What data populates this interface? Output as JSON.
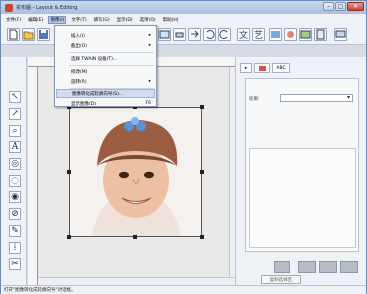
{
  "window": {
    "title": "花布圖 - Layout & Editing",
    "controls": [
      "–",
      "□",
      "✕"
    ]
  },
  "menubar": {
    "items": [
      {
        "label": "文件(F)"
      },
      {
        "label": "编辑(E)"
      },
      {
        "label": "图像(I)"
      },
      {
        "label": "文字(T)"
      },
      {
        "label": "填写(G)"
      },
      {
        "label": "显示(D)"
      },
      {
        "label": "选项(O)"
      },
      {
        "label": "帮助(H)"
      }
    ],
    "active_index": 2
  },
  "dropdown": {
    "items": [
      {
        "label": "插入(I)",
        "submenu": true
      },
      {
        "label": "截出(O)",
        "submenu": true
      },
      {
        "label": "选择 TWAIN 设备(T)..."
      },
      {
        "label": "修改(M)"
      },
      {
        "label": "旋转(R)",
        "submenu": true
      },
      {
        "label": "图像转化成轮廓向导(S)...",
        "highlighted": true
      },
      {
        "label": "显示图像(D)",
        "shortcut": "F6"
      }
    ]
  },
  "right_panel": {
    "tab_label": "ABC",
    "property_label": "轮廓:",
    "bottom_button": "复制选择区"
  },
  "statusbar": {
    "text": "打开\"图像转化成轮廓向导\"对话框。"
  },
  "colors": {
    "accent": "#b7cbe9",
    "title_gradient_top": "#c9d8ec",
    "canvas_bg": "#e9e9e9"
  }
}
